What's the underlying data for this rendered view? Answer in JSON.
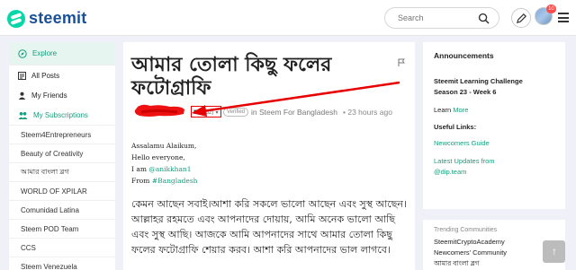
{
  "header": {
    "logo_text": "steemit",
    "search_placeholder": "Search",
    "notification_count": "10"
  },
  "sidebar": {
    "explore_label": "Explore",
    "all_posts_label": "All Posts",
    "my_friends_label": "My Friends",
    "my_subscriptions_label": "My Subscriptions",
    "communities": [
      "Steem4Entrepreneurs",
      "Beauty of Creativity",
      "আমার বাংলা ব্লগ",
      "WORLD OF XPILAR",
      "Comunidad Latina",
      "Steem POD Team",
      "CCS",
      "Steem Venezuela"
    ]
  },
  "post": {
    "title": "আমার তোলা কিছু ফলের ফটোগ্রাফি",
    "author_partial": "n1",
    "reputation": "(52)",
    "verified_label": "Verified",
    "community": "in Steem For Bangladesh",
    "time": "• 23 hours ago",
    "greeting_lines": [
      "Assalamu Alaikum,",
      "Hello everyone,"
    ],
    "i_am_prefix": "I am ",
    "i_am_link": "@anikkhan1",
    "from_prefix": "From ",
    "from_link": "#Bangladesh",
    "paragraph": "কেমন আছেন সবাই।আশা করি সকলে ভালো আছেন এবং সুস্থ আছেন। আল্লাহর রহমতে এবং আপনাদের দোয়ায়, আমি অনেক ভালো আছি এবং সুস্থ আছি। আজকে আমি আপনাদের সাথে আমার তোলা কিছু ফলের ফটোগ্রাফি শেয়ার করব। আশা করি আপনাদের ভাল লাগবে।"
  },
  "right_panel": {
    "announcements_title": "Announcements",
    "announcement_text": "Steemit Learning Challenge Season 23 - Week 6",
    "learn_prefix": "Learn ",
    "learn_more": "More",
    "useful_links_title": "Useful Links:",
    "links": [
      "Newcomers Guide",
      "Latest Updates from @dip.team"
    ]
  },
  "trending": {
    "title": "Trending Communities",
    "items": [
      "SteemitCryptoAcademy",
      "Newcomers' Community",
      "আমার বাংলা ব্লগ"
    ]
  },
  "colors": {
    "accent": "#1a9c7c",
    "brand": "#1a5099",
    "annotation_red": "#e60000"
  }
}
